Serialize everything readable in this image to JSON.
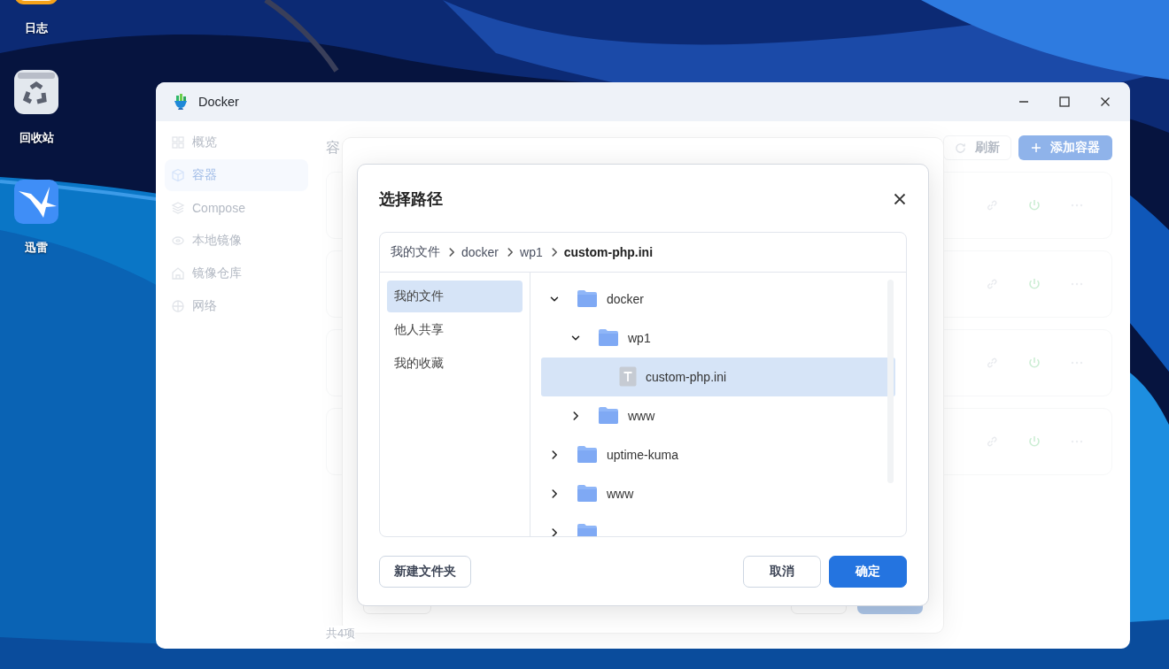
{
  "desktop_icons": [
    {
      "kind": "log",
      "label": "日志"
    },
    {
      "kind": "recycle",
      "label": "回收站"
    },
    {
      "kind": "bird",
      "label": "迅雷"
    }
  ],
  "window": {
    "title": "Docker",
    "sidebar": {
      "items": [
        {
          "kind": "grid",
          "label": "概览",
          "selected": false
        },
        {
          "kind": "cube",
          "label": "容器",
          "selected": true
        },
        {
          "kind": "layers",
          "label": "Compose",
          "selected": false
        },
        {
          "kind": "disk",
          "label": "本地镜像",
          "selected": false
        },
        {
          "kind": "house",
          "label": "镜像仓库",
          "selected": false
        },
        {
          "kind": "globe",
          "label": "网络",
          "selected": false
        }
      ]
    },
    "heading": "容",
    "toolbar": [
      {
        "kind": "refresh",
        "label": "刷新"
      },
      {
        "kind": "add",
        "label": "添加容器"
      }
    ],
    "container_cards": [
      {
        "running": true
      },
      {
        "running": true
      },
      {
        "running": true
      },
      {
        "running": true
      }
    ],
    "footer": "共4项"
  },
  "dialog": {
    "title": "选择路径",
    "breadcrumb": [
      {
        "label": "我的文件",
        "current": false
      },
      {
        "label": "docker",
        "current": false
      },
      {
        "label": "wp1",
        "current": false
      },
      {
        "label": "custom-php.ini",
        "current": true
      }
    ],
    "places": [
      {
        "label": "我的文件",
        "selected": true
      },
      {
        "label": "他人共享",
        "selected": false
      },
      {
        "label": "我的收藏",
        "selected": false
      }
    ],
    "tree": [
      {
        "kind": "folder",
        "name": "docker",
        "expanded": true,
        "selected": false,
        "children": [
          {
            "kind": "folder",
            "name": "wp1",
            "expanded": true,
            "selected": false,
            "children": [
              {
                "kind": "file",
                "name": "custom-php.ini",
                "selected": true
              }
            ]
          },
          {
            "kind": "folder",
            "name": "www",
            "expanded": false,
            "selected": false
          }
        ]
      },
      {
        "kind": "folder",
        "name": "uptime-kuma",
        "expanded": false,
        "selected": false
      },
      {
        "kind": "folder",
        "name": "www",
        "expanded": false,
        "selected": false
      },
      {
        "kind": "folder",
        "expanded": false,
        "selected": false
      }
    ],
    "buttons": {
      "new_folder": "新建文件夹",
      "cancel": "取消",
      "confirm": "确定"
    }
  }
}
